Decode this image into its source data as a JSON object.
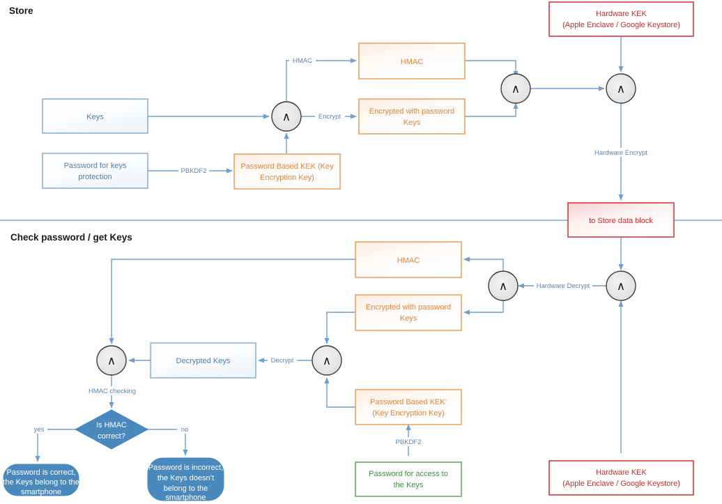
{
  "sections": [
    {
      "id": "store",
      "title": "Store"
    },
    {
      "id": "check",
      "title": "Check password / get Keys"
    }
  ],
  "store": {
    "nodes": {
      "keys": "Keys",
      "password_for_keys_protection": "Password for keys\nprotection",
      "password_based_kek": "Password Based KEK (Key\nEncryption Key)",
      "hmac": "HMAC",
      "encrypted_with_password_keys": "Encrypted with password\nKeys",
      "hardware_kek": "Hardware KEK\n(Apple Enclave / Google Keystore)",
      "hardware_kek_line1": "Hardware KEK",
      "hardware_kek_line2": "(Apple Enclave / Google Keystore)",
      "to_store_data_block": "to Store data block",
      "gate_glyph": "∧"
    },
    "edge_labels": {
      "pbkdf2": "PBKDF2",
      "hmac": "HMAC",
      "encrypt": "Encrypt",
      "hardware_encrypt": "Hardware Encrypt"
    },
    "node_lines": {
      "password_for_keys_protection": [
        "Password for keys",
        "protection"
      ],
      "password_based_kek": [
        "Password Based KEK (Key",
        "Encryption Key)"
      ],
      "encrypted_with_password_keys": [
        "Encrypted with password",
        "Keys"
      ],
      "hardware_kek": [
        "Hardware KEK",
        "(Apple Enclave / Google Keystore)"
      ]
    }
  },
  "check": {
    "nodes": {
      "hmac": "HMAC",
      "encrypted_with_password_keys": "Encrypted with password\nKeys",
      "decrypted_keys": "Decrypted Keys",
      "password_based_kek_prime": "Password Based KEK’\n(Key Encryption Key)",
      "password_for_access": "Password for access to\nthe Keys",
      "hardware_kek": "Hardware KEK\n(Apple Enclave / Google Keystore)",
      "decision": "Is HMAC\ncorrect?",
      "result_yes": "Password is correct,\nthe Keys belong to the\nsmartphone",
      "result_no": "Password is incorrect,\nthe Keys doesn’t\nbelong to the\nsmartphone",
      "gate_glyph": "∧"
    },
    "edge_labels": {
      "hardware_decrypt": "Hardware Decrypt",
      "decrypt": "Decrypt",
      "pbkdf2": "PBKDF2",
      "hmac_checking": "HMAC checking",
      "yes": "yes",
      "no": "no"
    },
    "node_lines": {
      "encrypted_with_password_keys": [
        "Encrypted with password",
        "Keys"
      ],
      "password_based_kek_prime": [
        "Password Based KEK’",
        "(Key Encryption Key)"
      ],
      "password_for_access": [
        "Password for access to",
        "the Keys"
      ],
      "hardware_kek": [
        "Hardware KEK",
        "(Apple Enclave / Google Keystore)"
      ],
      "decision": [
        "Is HMAC",
        "correct?"
      ],
      "result_yes": [
        "Password is correct,",
        "the Keys belong to the",
        "smartphone"
      ],
      "result_no": [
        "Password is incorrect,",
        "the Keys doesn’t",
        "belong to the",
        "smartphone"
      ]
    }
  },
  "colors": {
    "edge": "#6f9fcf",
    "divider": "#5b9bd5",
    "blue_stroke": "#7ba7d0",
    "blue_text": "#4a7fb5",
    "orange_stroke": "#e8984e",
    "orange_text": "#e8833a",
    "red_stroke": "#d33b3b",
    "red_text": "#d42a2a",
    "green_stroke": "#4aa24d",
    "green_text": "#3f9142",
    "solid_blue_fill": "#4a89bd",
    "gate_fill": "#e6e6e6",
    "title_text": "#1a1a1a"
  }
}
